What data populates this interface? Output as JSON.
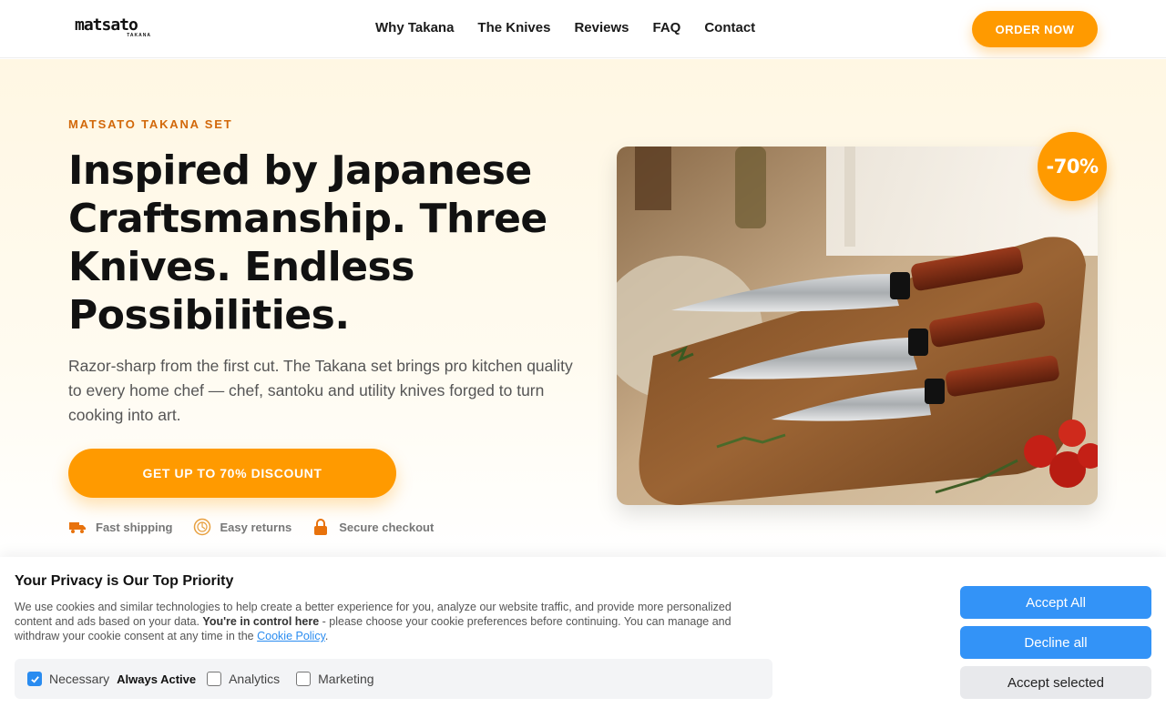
{
  "header": {
    "logo_text": "matsato",
    "logo_sub": "TAKANA",
    "nav": [
      "Why Takana",
      "The Knives",
      "Reviews",
      "FAQ",
      "Contact"
    ],
    "order_label": "ORDER NOW"
  },
  "hero": {
    "eyebrow": "MATSATO TAKANA SET",
    "headline": "Inspired by Japanese Craftsmanship. Three Knives. Endless Possibilities.",
    "subtext": "Razor-sharp from the first cut. The Takana set brings pro kitchen quality to every home chef — chef, santoku and utility knives forged to turn cooking into art.",
    "cta_label": "GET UP TO 70% DISCOUNT",
    "badge": "-70%",
    "trust": [
      {
        "icon": "truck-icon",
        "label": "Fast shipping"
      },
      {
        "icon": "returns-icon",
        "label": "Easy returns"
      },
      {
        "icon": "lock-icon",
        "label": "Secure checkout"
      }
    ]
  },
  "cookie": {
    "title": "Your Privacy is Our Top Priority",
    "text_1": "We use cookies and similar technologies to help create a better experience for you, analyze our website traffic, and provide more personalized content and ads based on your data. ",
    "text_bold": "You're in control here",
    "text_2": " - please choose your cookie preferences before continuing. You can manage and withdraw your cookie consent at any time in the ",
    "link": "Cookie Policy",
    "text_end": ".",
    "necessary": "Necessary",
    "always_active": "Always Active",
    "analytics": "Analytics",
    "marketing": "Marketing",
    "accept_all": "Accept All",
    "decline_all": "Decline all",
    "accept_selected": "Accept selected"
  },
  "colors": {
    "accent": "#ff9a00",
    "eyebrow": "#d2680a",
    "button_blue": "#3393f7"
  }
}
